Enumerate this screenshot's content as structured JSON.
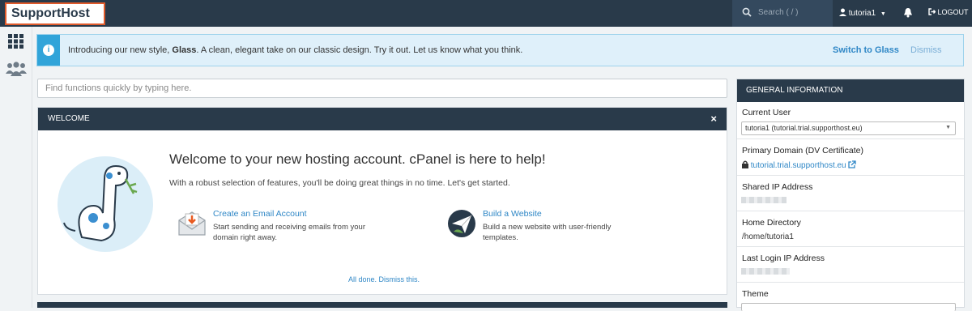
{
  "brand": "SupportHost",
  "header": {
    "search_placeholder": "Search ( / )",
    "user": "tutoria1",
    "logout": "LOGOUT"
  },
  "notice": {
    "text_before": "Introducing our new style, ",
    "style_name": "Glass",
    "text_after": ". A clean, elegant take on our classic design. Try it out. Let us know what you think.",
    "switch": "Switch to Glass",
    "dismiss": "Dismiss"
  },
  "quick_find_placeholder": "Find functions quickly by typing here.",
  "welcome": {
    "header": "WELCOME",
    "close": "×",
    "title": "Welcome to your new hosting account. cPanel is here to help!",
    "subtitle": "With a robust selection of features, you'll be doing great things in no time. Let's get started.",
    "actions": [
      {
        "label": "Create an Email Account",
        "desc": "Start sending and receiving emails from your domain right away."
      },
      {
        "label": "Build a Website",
        "desc": "Build a new website with user-friendly templates."
      }
    ],
    "all_done": "All done. Dismiss this."
  },
  "general_info": {
    "header": "GENERAL INFORMATION",
    "current_user_label": "Current User",
    "current_user_value": "tutoria1 (tutorial.trial.supporthost.eu)",
    "primary_domain_label": "Primary Domain (DV Certificate)",
    "primary_domain_value": "tutorial.trial.supporthost.eu",
    "shared_ip_label": "Shared IP Address",
    "home_dir_label": "Home Directory",
    "home_dir_value": "/home/tutoria1",
    "last_login_label": "Last Login IP Address",
    "theme_label": "Theme"
  }
}
